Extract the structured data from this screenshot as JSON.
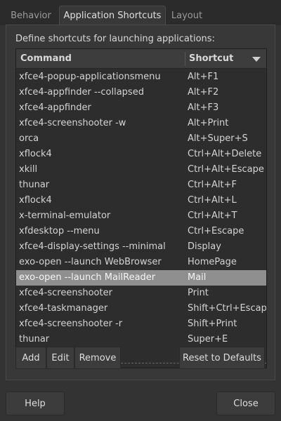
{
  "tabs": [
    {
      "label": "Behavior",
      "active": false
    },
    {
      "label": "Application Shortcuts",
      "active": true
    },
    {
      "label": "Layout",
      "active": false
    }
  ],
  "description": "Define shortcuts for launching applications:",
  "table": {
    "headers": {
      "command": "Command",
      "shortcut": "Shortcut"
    },
    "sort": "descending",
    "selected_index": 13,
    "rows": [
      {
        "command": "xfce4-popup-applicationsmenu",
        "shortcut": "Alt+F1"
      },
      {
        "command": "xfce4-appfinder --collapsed",
        "shortcut": "Alt+F2"
      },
      {
        "command": "xfce4-appfinder",
        "shortcut": "Alt+F3"
      },
      {
        "command": "xfce4-screenshooter -w",
        "shortcut": "Alt+Print"
      },
      {
        "command": "orca",
        "shortcut": "Alt+Super+S"
      },
      {
        "command": "xflock4",
        "shortcut": "Ctrl+Alt+Delete"
      },
      {
        "command": "xkill",
        "shortcut": "Ctrl+Alt+Escape"
      },
      {
        "command": "thunar",
        "shortcut": "Ctrl+Alt+F"
      },
      {
        "command": "xflock4",
        "shortcut": "Ctrl+Alt+L"
      },
      {
        "command": "x-terminal-emulator",
        "shortcut": "Ctrl+Alt+T"
      },
      {
        "command": "xfdesktop --menu",
        "shortcut": "Ctrl+Escape"
      },
      {
        "command": "xfce4-display-settings --minimal",
        "shortcut": "Display"
      },
      {
        "command": "exo-open --launch WebBrowser",
        "shortcut": "HomePage"
      },
      {
        "command": "exo-open --launch MailReader",
        "shortcut": "Mail"
      },
      {
        "command": "xfce4-screenshooter",
        "shortcut": "Print"
      },
      {
        "command": "xfce4-taskmanager",
        "shortcut": "Shift+Ctrl+Escape"
      },
      {
        "command": "xfce4-screenshooter -r",
        "shortcut": "Shift+Print"
      },
      {
        "command": "thunar",
        "shortcut": "Super+E"
      }
    ]
  },
  "buttons": {
    "add": "Add",
    "edit": "Edit",
    "remove": "Remove",
    "reset": "Reset to Defaults",
    "help": "Help",
    "close": "Close"
  }
}
